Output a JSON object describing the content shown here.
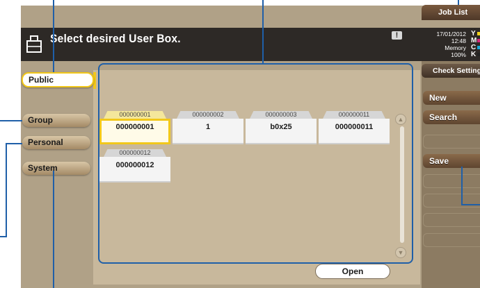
{
  "header": {
    "title": "Select desired User Box.",
    "warning_glyph": "!",
    "status": {
      "date": "17/01/2012",
      "time": "12:48",
      "memory_label": "Memory",
      "memory_value": "100%"
    },
    "toner": [
      "Y",
      "M",
      "C",
      "K"
    ],
    "toner_colors": [
      "#f2d21a",
      "#d6287a",
      "#1aa6d6",
      "#222222"
    ]
  },
  "right_panel": {
    "job_list": "Job List",
    "check_setting": "Check Setting",
    "new": "New",
    "search": "Search",
    "save": "Save",
    "disabled_items": [
      "",
      "",
      "",
      "",
      ""
    ]
  },
  "tabs": [
    {
      "label": "Public",
      "active": true
    },
    {
      "label": "Group",
      "active": false
    },
    {
      "label": "Personal",
      "active": false
    },
    {
      "label": "System",
      "active": false
    }
  ],
  "boxes": [
    {
      "number": "000000001",
      "name": "000000001",
      "selected": true
    },
    {
      "number": "000000002",
      "name": "1",
      "selected": false
    },
    {
      "number": "000000003",
      "name": "b0x25",
      "selected": false
    },
    {
      "number": "000000011",
      "name": "000000011",
      "selected": false
    },
    {
      "number": "000000012",
      "name": "000000012",
      "selected": false
    }
  ],
  "open_button": "Open",
  "colors": {
    "accent": "#f2c81a",
    "callout": "#1f5fa8",
    "panel": "#b0a187",
    "titlebar": "#2d2926"
  }
}
